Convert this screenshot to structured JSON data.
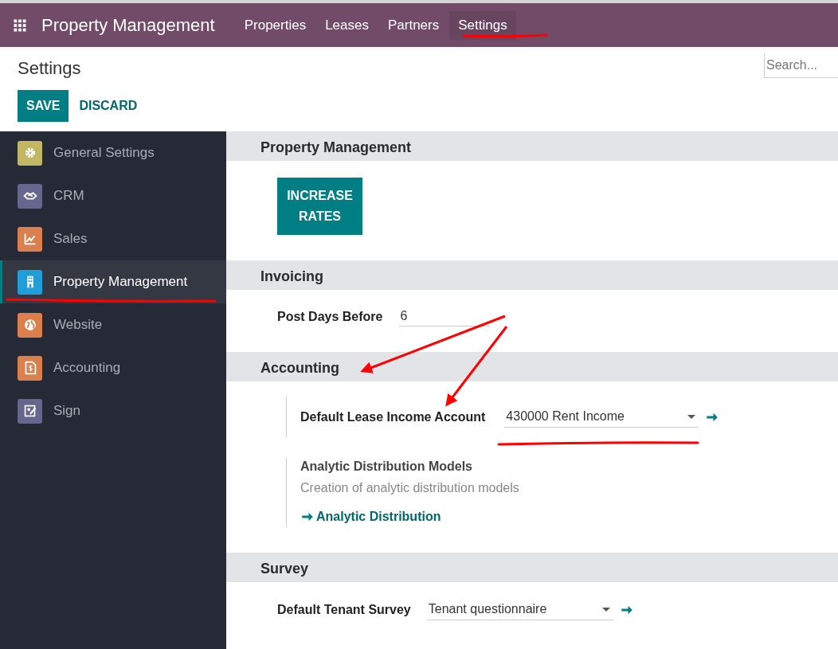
{
  "navbar": {
    "app_name": "Property Management",
    "menu": [
      {
        "label": "Properties",
        "selected": false
      },
      {
        "label": "Leases",
        "selected": false
      },
      {
        "label": "Partners",
        "selected": false
      },
      {
        "label": "Settings",
        "selected": true
      }
    ]
  },
  "control_panel": {
    "title": "Settings",
    "search": {
      "placeholder": "Search..."
    },
    "buttons": [
      {
        "label": "SAVE",
        "kind": "primary"
      },
      {
        "label": "DISCARD",
        "kind": "secondary"
      }
    ]
  },
  "sidebar": {
    "items": [
      {
        "label": "General Settings",
        "color": "#c3b766",
        "selected": false
      },
      {
        "label": "CRM",
        "color": "#66668f",
        "selected": false
      },
      {
        "label": "Sales",
        "color": "#d9804e",
        "selected": false
      },
      {
        "label": "Property Management",
        "color": "#1f9ed9",
        "selected": true
      },
      {
        "label": "Website",
        "color": "#d9804e",
        "selected": false
      },
      {
        "label": "Accounting",
        "color": "#d9804e",
        "selected": false
      },
      {
        "label": "Sign",
        "color": "#66668f",
        "selected": false
      }
    ]
  },
  "sections": [
    {
      "title": "Property Management",
      "settings": [
        {
          "kind": "button",
          "label": "INCREASE RATES"
        }
      ]
    },
    {
      "title": "Invoicing",
      "settings": [
        {
          "kind": "field",
          "label": "Post Days Before",
          "value": "6"
        }
      ]
    },
    {
      "title": "Accounting",
      "settings": [
        {
          "kind": "boxedselect",
          "label": "Default Lease Income Account",
          "value": "430000 Rent Income"
        },
        {
          "kind": "boxedinfo",
          "title": "Analytic Distribution Models",
          "description": "Creation of analytic distribution models",
          "link": "Analytic Distribution"
        }
      ]
    },
    {
      "title": "Survey",
      "settings": [
        {
          "kind": "select",
          "label": "Default Tenant Survey",
          "value": "Tenant questionnaire"
        }
      ]
    }
  ]
}
